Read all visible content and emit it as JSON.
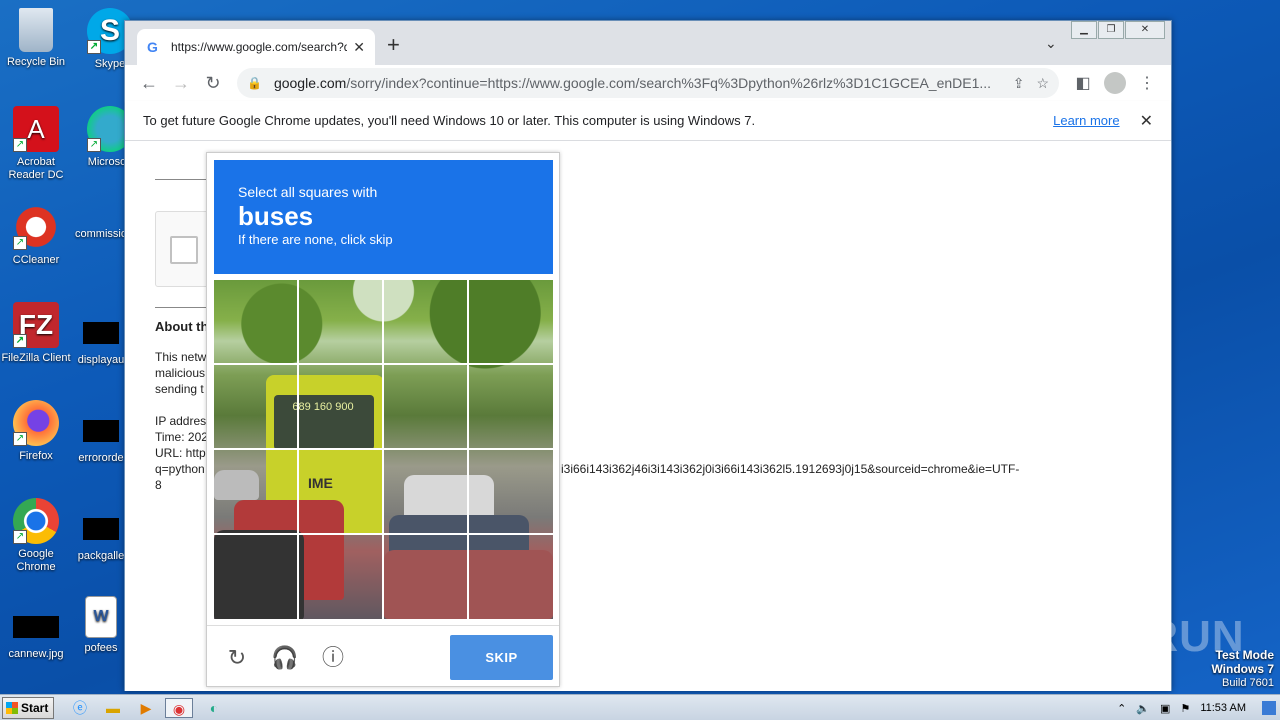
{
  "desktop": {
    "icons": [
      {
        "label": "Recycle Bin"
      },
      {
        "label": "Skype"
      },
      {
        "label": "Acrobat Reader DC"
      },
      {
        "label": "Microsoft"
      },
      {
        "label": "CCleaner"
      },
      {
        "label": "commissio"
      },
      {
        "label": "FileZilla Client"
      },
      {
        "label": "displayau"
      },
      {
        "label": "Firefox"
      },
      {
        "label": "errororde"
      },
      {
        "label": "Google Chrome"
      },
      {
        "label": "packgalle"
      },
      {
        "label": "cannew.jpg"
      },
      {
        "label": "pofees"
      }
    ]
  },
  "browser": {
    "tab_title": "https://www.google.com/search?q=",
    "url_host": "google.com",
    "url_path": "/sorry/index?continue=https://www.google.com/search%3Fq%3Dpython%26rlz%3D1C1GCEA_enDE1...",
    "infobar_message": "To get future Google Chrome updates, you'll need Windows 10 or later. This computer is using Windows 7.",
    "infobar_link": "Learn more"
  },
  "page": {
    "about_heading": "About th",
    "para1": [
      "This netw",
      "malicious",
      "sending t"
    ],
    "ip_label": "IP addres",
    "time_label": "Time: 202",
    "url_label": "URL: http",
    "url_cont": "q=python",
    "url_tail": "i3i66i143i362j46i3i143i362j0i3i66i143i362l5.1912693j0j15&sourceid=chrome&ie=UTF-",
    "url_end": "8"
  },
  "captcha": {
    "line1": "Select all squares with",
    "target": "buses",
    "line3": "If there are none, click skip",
    "bus_dest": "689 160 900",
    "bus_logo": "IME",
    "skip_label": "SKIP",
    "footer_icons": [
      "reload-icon",
      "audio-icon",
      "info-icon"
    ]
  },
  "taskbar": {
    "start_label": "Start",
    "clock": "11:53 AM"
  },
  "overlay": {
    "watermark": "ANY RUN",
    "testmode_line1": "Test Mode",
    "testmode_line2": "Windows 7",
    "testmode_line3": "Build 7601"
  },
  "colors": {
    "captcha_header": "#1a73e8",
    "skip_button": "#4a90e2",
    "link": "#1a73e8"
  }
}
